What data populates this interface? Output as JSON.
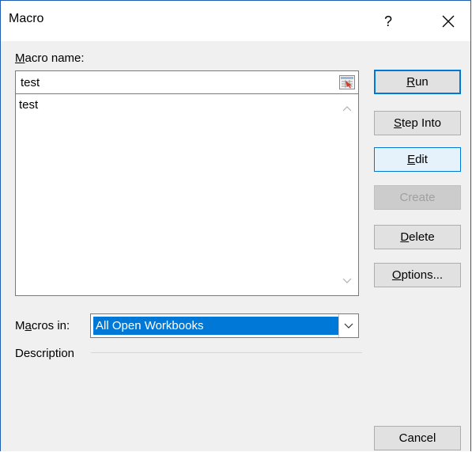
{
  "dialog": {
    "title": "Macro",
    "help_label": "?",
    "close_label": "Close"
  },
  "macro_name": {
    "label_prefix": "",
    "label_mnemonic": "M",
    "label_rest": "acro name:",
    "value": "test"
  },
  "macro_list": {
    "items": [
      "test"
    ]
  },
  "buttons": {
    "run": {
      "mnemonic": "R",
      "rest": "un"
    },
    "step_into": {
      "mnemonic": "S",
      "rest": "tep Into"
    },
    "edit": {
      "mnemonic": "E",
      "rest": "dit"
    },
    "create": {
      "label": "Create"
    },
    "delete": {
      "mnemonic": "D",
      "rest": "elete"
    },
    "options": {
      "mnemonic": "O",
      "rest": "ptions..."
    },
    "cancel": {
      "label": "Cancel"
    }
  },
  "macros_in": {
    "label_prefix": "M",
    "label_mnemonic": "a",
    "label_rest": "cros in:",
    "selected": "All Open Workbooks"
  },
  "description": {
    "label": "Description"
  },
  "colors": {
    "accent": "#0078d7",
    "dialog_background": "#f0f0f0",
    "border": "#1e5fb4"
  }
}
